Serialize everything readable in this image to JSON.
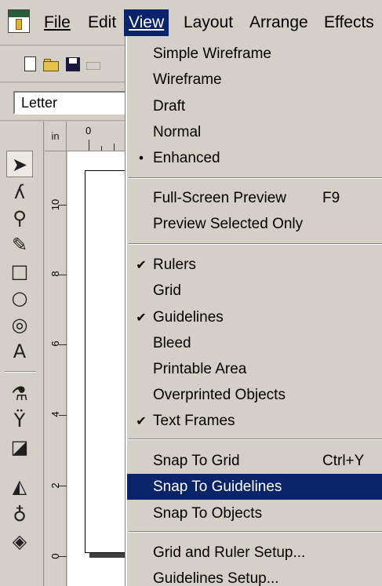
{
  "menubar": {
    "items": [
      {
        "label": "File"
      },
      {
        "label": "Edit"
      },
      {
        "label": "View"
      },
      {
        "label": "Layout"
      },
      {
        "label": "Arrange"
      },
      {
        "label": "Effects"
      }
    ],
    "active_item": "View"
  },
  "propbar": {
    "paper_size": "Letter"
  },
  "rulers": {
    "corner_label": "in",
    "horizontal_labels": [
      "0"
    ],
    "vertical_labels": [
      "10",
      "8",
      "6",
      "4",
      "2",
      "0"
    ]
  },
  "toolbox": {
    "tools": [
      "pick-tool",
      "shape-tool",
      "zoom-tool",
      "freehand-tool",
      "rectangle-tool",
      "ellipse-tool",
      "spiral-tool",
      "text-tool",
      "eyedropper-tool",
      "interactive-blend-tool",
      "outline-tool",
      "fill-tool",
      "interactive-fill-tool"
    ]
  },
  "view_menu": {
    "items": [
      {
        "label": "Simple Wireframe",
        "checked": false,
        "bullet": false,
        "shortcut": ""
      },
      {
        "label": "Wireframe",
        "checked": false,
        "bullet": false,
        "shortcut": ""
      },
      {
        "label": "Draft",
        "checked": false,
        "bullet": false,
        "shortcut": ""
      },
      {
        "label": "Normal",
        "checked": false,
        "bullet": false,
        "shortcut": ""
      },
      {
        "label": "Enhanced",
        "checked": false,
        "bullet": true,
        "shortcut": ""
      },
      {
        "label": "Full-Screen Preview",
        "checked": false,
        "bullet": false,
        "shortcut": "F9"
      },
      {
        "label": "Preview Selected Only",
        "checked": false,
        "bullet": false,
        "shortcut": ""
      },
      {
        "label": "Rulers",
        "checked": true,
        "bullet": false,
        "shortcut": ""
      },
      {
        "label": "Grid",
        "checked": false,
        "bullet": false,
        "shortcut": ""
      },
      {
        "label": "Guidelines",
        "checked": true,
        "bullet": false,
        "shortcut": ""
      },
      {
        "label": "Bleed",
        "checked": false,
        "bullet": false,
        "shortcut": ""
      },
      {
        "label": "Printable Area",
        "checked": false,
        "bullet": false,
        "shortcut": ""
      },
      {
        "label": "Overprinted Objects",
        "checked": false,
        "bullet": false,
        "shortcut": ""
      },
      {
        "label": "Text Frames",
        "checked": true,
        "bullet": false,
        "shortcut": ""
      },
      {
        "label": "Snap To Grid",
        "checked": false,
        "bullet": false,
        "shortcut": "Ctrl+Y"
      },
      {
        "label": "Snap To Guidelines",
        "checked": false,
        "bullet": false,
        "shortcut": "",
        "highlighted": true
      },
      {
        "label": "Snap To Objects",
        "checked": false,
        "bullet": false,
        "shortcut": ""
      },
      {
        "label": "Grid and Ruler Setup...",
        "checked": false,
        "bullet": false,
        "shortcut": ""
      },
      {
        "label": "Guidelines Setup...",
        "checked": false,
        "bullet": false,
        "shortcut": ""
      }
    ],
    "check_glyph": "✔",
    "bullet_glyph": "•"
  },
  "colors": {
    "chrome": "#d4d0c8",
    "highlight": "#0a246a",
    "highlight_text": "#ffffff",
    "canvas": "#ffffff"
  }
}
